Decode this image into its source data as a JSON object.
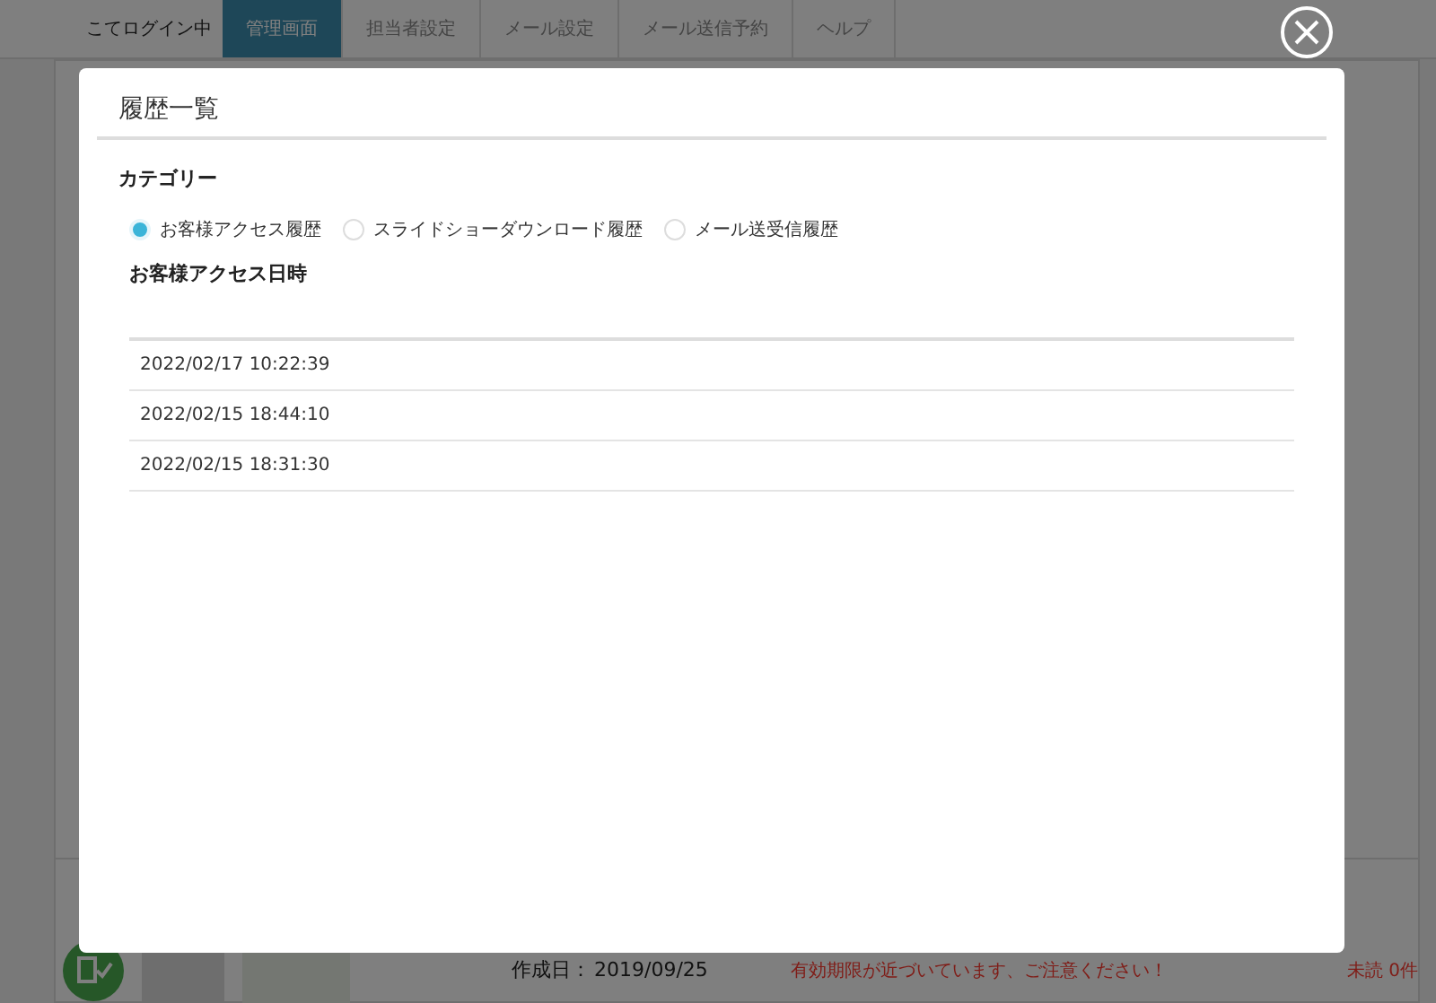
{
  "header": {
    "login_status": "こてログイン中",
    "tabs": [
      {
        "label": "管理画面",
        "selected": true
      },
      {
        "label": "担当者設定",
        "selected": false
      },
      {
        "label": "メール設定",
        "selected": false
      },
      {
        "label": "メール送信予約",
        "selected": false
      },
      {
        "label": "ヘルプ",
        "selected": false
      }
    ]
  },
  "background": {
    "created_label": "作成日：",
    "created_date": "2019/09/25",
    "notice": "有効期限が近づいています、ご注意ください！",
    "unread": "未読 0件"
  },
  "modal": {
    "title": "履歴一覧",
    "category_label": "カテゴリー",
    "categories": [
      {
        "label": "お客様アクセス履歴",
        "selected": true
      },
      {
        "label": "スライドショーダウンロード履歴",
        "selected": false
      },
      {
        "label": "メール送受信履歴",
        "selected": false
      }
    ],
    "list_heading": "お客様アクセス日時",
    "rows": [
      "2022/02/17 10:22:39",
      "2022/02/15 18:44:10",
      "2022/02/15 18:31:30"
    ]
  }
}
